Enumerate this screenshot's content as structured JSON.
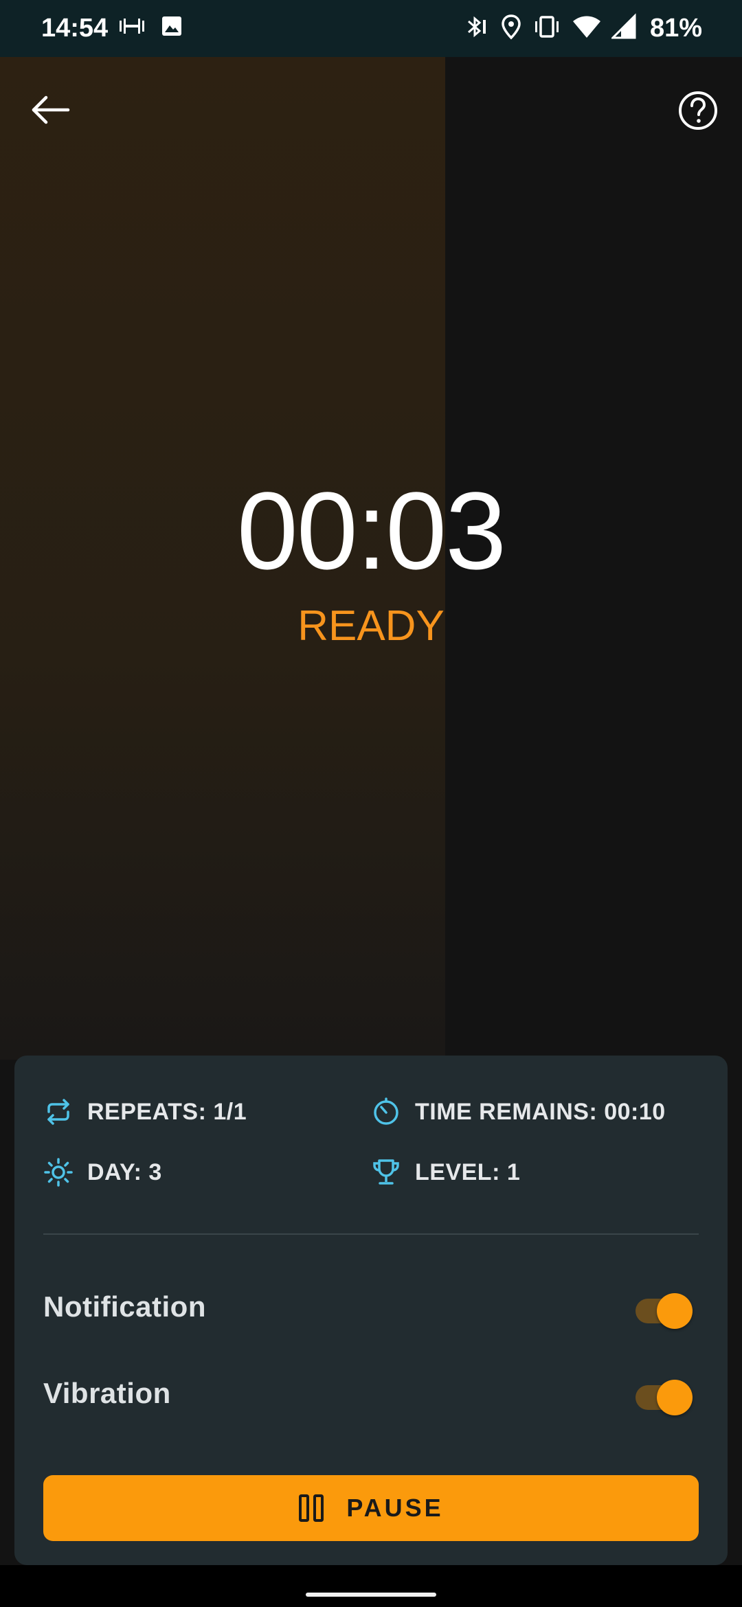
{
  "status_bar": {
    "time": "14:54",
    "battery": "81%",
    "left_icons": [
      "dumbbell-icon",
      "image-icon"
    ],
    "right_icons": [
      "bluetooth-icon",
      "location-icon",
      "vibrate-icon",
      "wifi-icon",
      "signal-icon"
    ]
  },
  "timer": {
    "value": "00:03",
    "state": "READY",
    "progress": 0.6,
    "state_color": "#f7941d"
  },
  "stats": {
    "repeats": "REPEATS: 1/1",
    "time_remains": "TIME REMAINS: 00:10",
    "day": "DAY: 3",
    "level": "LEVEL: 1"
  },
  "settings": {
    "notification_label": "Notification",
    "notification_on": true,
    "vibration_label": "Vibration",
    "vibration_on": true
  },
  "pause_button": {
    "label": "PAUSE"
  },
  "colors": {
    "accent": "#fb9a0c",
    "icon_tint": "#4fc3e8",
    "card_bg": "#222c30",
    "status_bar_bg": "#0e2226"
  }
}
